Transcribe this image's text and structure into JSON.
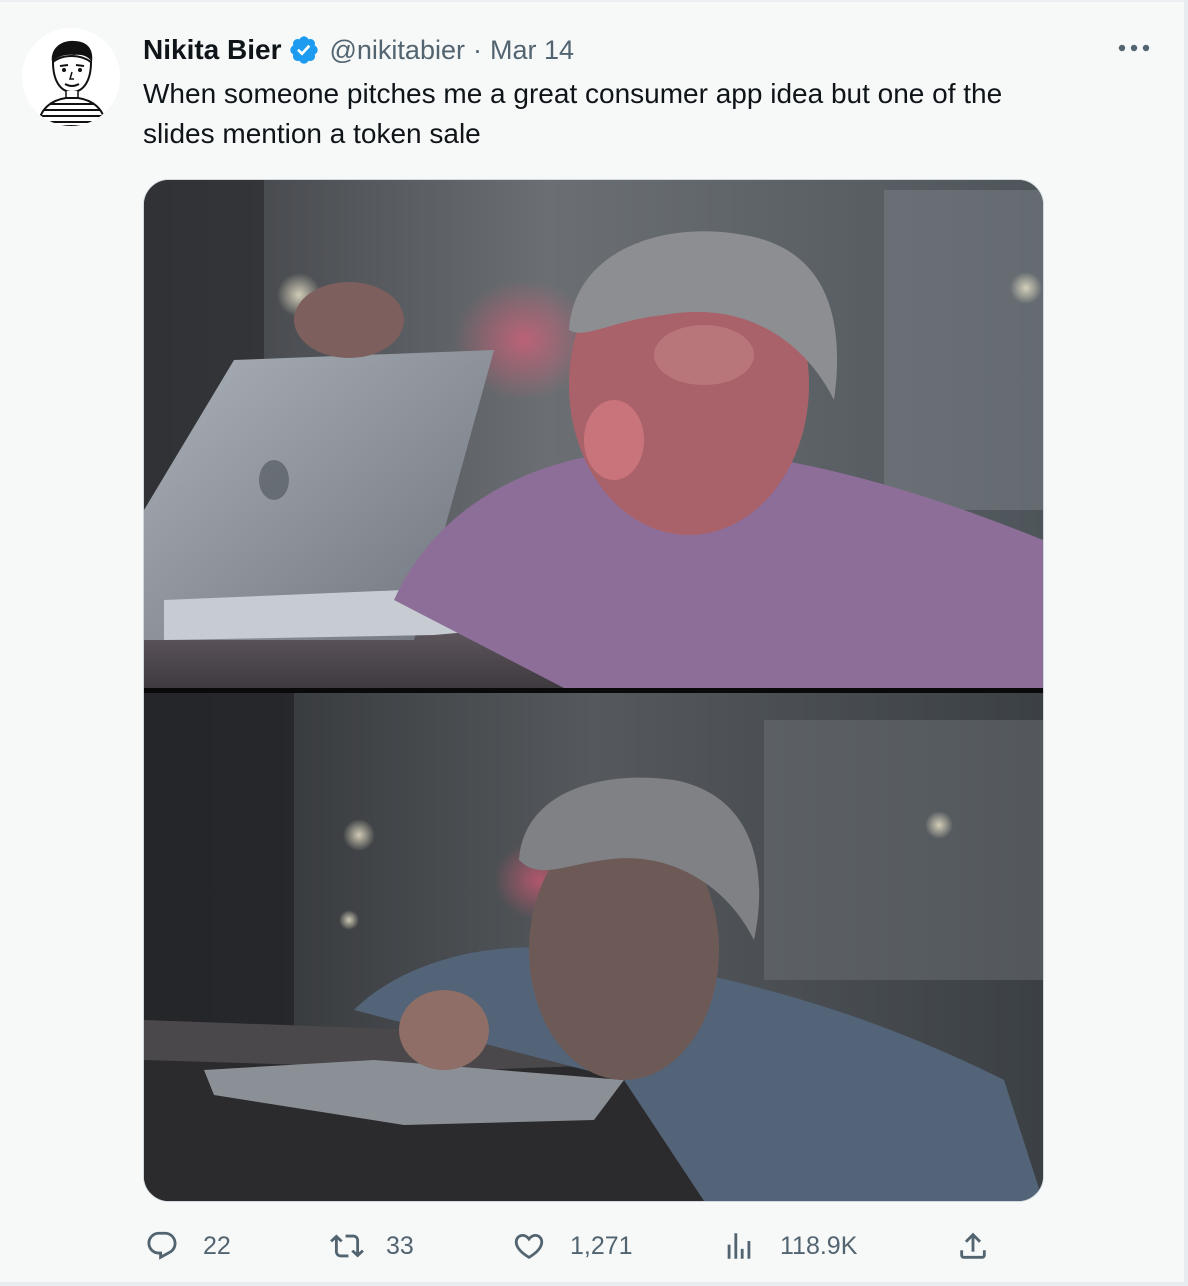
{
  "tweet": {
    "author": {
      "name": "Nikita Bier",
      "handle": "@nikitabier",
      "verified": true,
      "avatar_icon": "sketch-portrait-avatar"
    },
    "separator": "·",
    "date": "Mar 14",
    "text": "When someone pitches me a great consumer app idea but one of the\nslides mention a token sale",
    "media": {
      "type": "image",
      "panels": 2
    },
    "actions": {
      "replies": "22",
      "retweets": "33",
      "likes": "1,271",
      "views": "118.9K"
    }
  },
  "icons": {
    "verified": "verified-badge-icon",
    "more": "more-options-icon",
    "reply": "reply-icon",
    "retweet": "retweet-icon",
    "like": "heart-icon",
    "views": "views-chart-icon",
    "share": "share-icon"
  },
  "colors": {
    "background": "#f7f9f9",
    "text_primary": "#0f1419",
    "text_secondary": "#536471",
    "verified_blue": "#1d9bf0"
  }
}
